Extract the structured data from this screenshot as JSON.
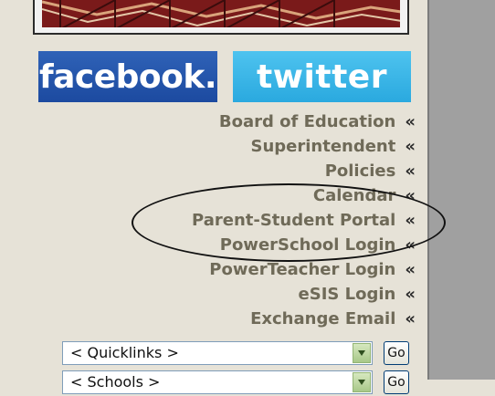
{
  "social": {
    "facebook": "facebook",
    "facebook_dot": ".",
    "twitter": "twitter"
  },
  "nav": {
    "items": [
      {
        "label": "Board of Education"
      },
      {
        "label": "Superintendent"
      },
      {
        "label": "Policies"
      },
      {
        "label": "Calendar"
      },
      {
        "label": "Parent-Student Portal"
      },
      {
        "label": "PowerSchool Login"
      },
      {
        "label": "PowerTeacher Login"
      },
      {
        "label": "eSIS Login"
      },
      {
        "label": "Exchange Email"
      }
    ],
    "arrow": "«"
  },
  "quicklinks": {
    "selected": "< Quicklinks >",
    "go_label": "Go"
  },
  "second_dropdown": {
    "selected": "< Schools >",
    "go_label": "Go"
  },
  "colors": {
    "facebook": "#1c4aa0",
    "twitter": "#2aa9df",
    "link": "#6f6a58",
    "background": "#e6e2d7"
  }
}
